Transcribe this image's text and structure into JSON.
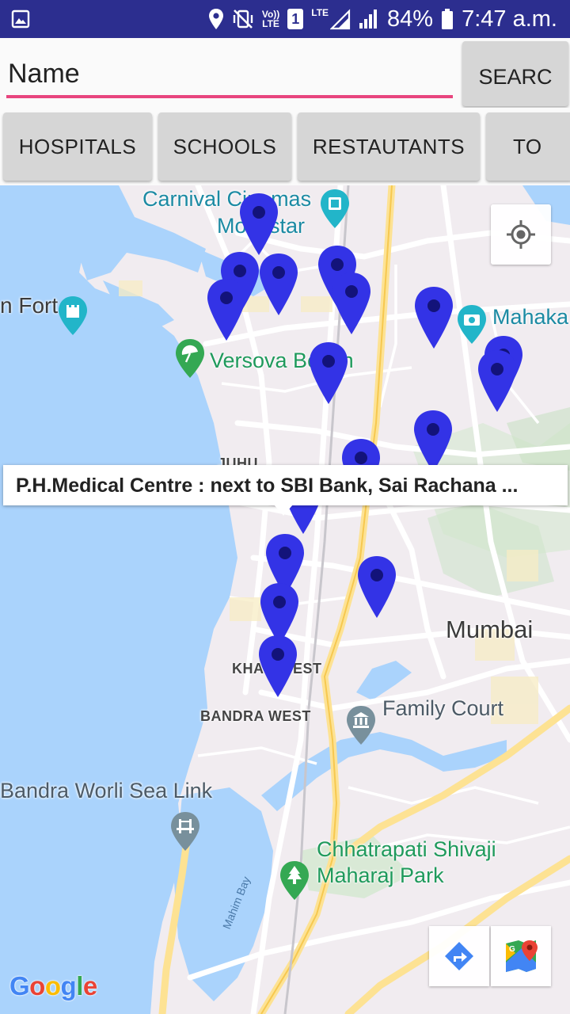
{
  "status_bar": {
    "volte_top": "Vo))",
    "volte_bottom": "LTE",
    "sim_slot": "1",
    "network_type": "LTE",
    "battery": "84%",
    "time": "7:47 a.m."
  },
  "search": {
    "placeholder": "Name",
    "button_label": "SEARC"
  },
  "categories": [
    "HOSPITALS",
    "SCHOOLS",
    "RESTAUTANTS",
    "TO"
  ],
  "map": {
    "labels": {
      "carnival_line1": "Carnival Cinemas",
      "carnival_line2": "Mokestar",
      "fort": "n Fort",
      "mahakali": "Mahaka",
      "versova": "Versova Beach",
      "juhu": "JUHU",
      "mumbai": "Mumbai",
      "khar": "KHAR WEST",
      "bandra_west": "BANDRA WEST",
      "family_court": "Family Court",
      "sea_link": "Bandra Worli Sea Link",
      "park_line1": "Chhatrapati Shivaji",
      "park_line2": "Maharaj Park",
      "mahim_bay": "Mahim Bay"
    },
    "info_window": "P.H.Medical Centre : next to SBI Bank, Sai Rachana ...",
    "marker_count": 18,
    "logo": "Google"
  },
  "colors": {
    "status_bar": "#2c2e8f",
    "input_underline": "#e8457e",
    "marker": "#3333e6",
    "water": "#aad3fc",
    "road": "#fde293"
  },
  "icons": [
    "gallery-icon",
    "location-icon",
    "vibrate-off-icon",
    "signal-icon",
    "battery-icon",
    "my-location-icon",
    "directions-icon",
    "google-maps-icon"
  ]
}
